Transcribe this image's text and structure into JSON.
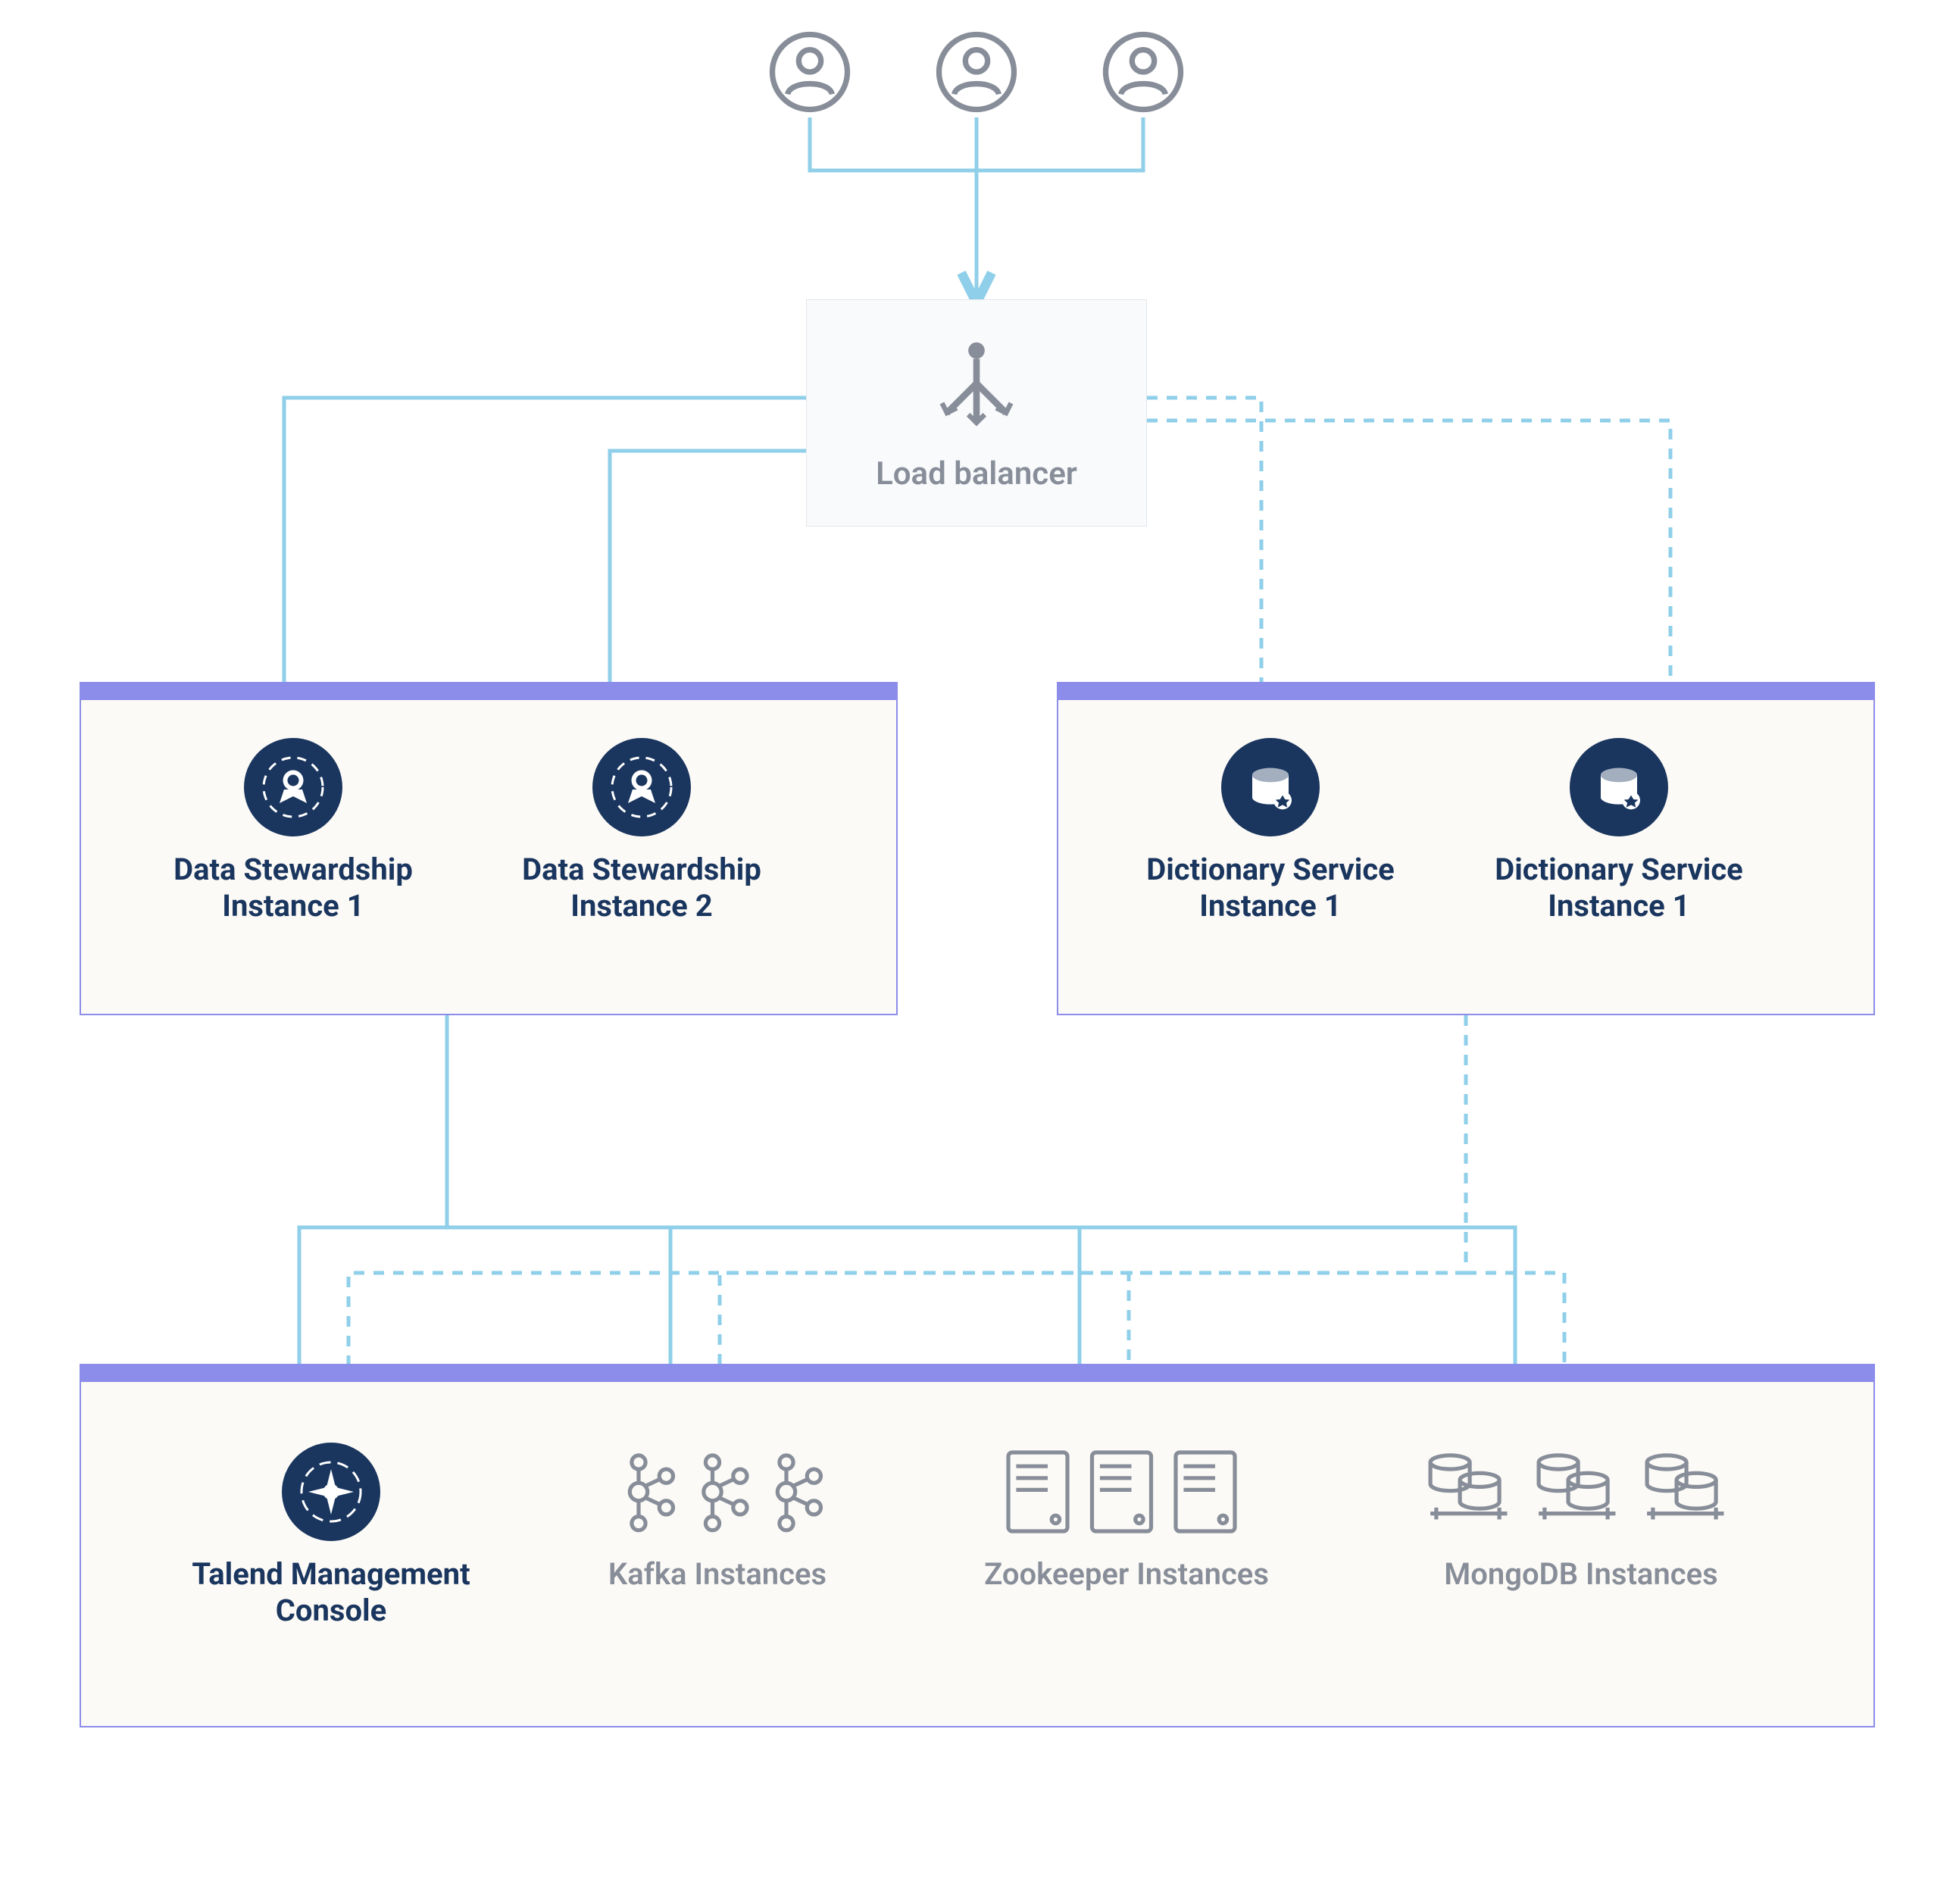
{
  "users": {
    "count": 3
  },
  "load_balancer": {
    "label": "Load balancer"
  },
  "panels": {
    "left": {
      "nodes": [
        {
          "label_l1": "Data Stewardship",
          "label_l2": "Instance 1"
        },
        {
          "label_l1": "Data Stewardship",
          "label_l2": "Instance 2"
        }
      ]
    },
    "right": {
      "nodes": [
        {
          "label_l1": "Dictionary Service",
          "label_l2": "Instance 1"
        },
        {
          "label_l1": "Dictionary Service",
          "label_l2": "Instance 1"
        }
      ]
    },
    "bottom": {
      "nodes": [
        {
          "label_l1": "Talend Management",
          "label_l2": "Console",
          "kind": "tmc"
        },
        {
          "label_l1": "Kafka Instances",
          "label_l2": "",
          "kind": "kafka"
        },
        {
          "label_l1": "Zookeeper Instances",
          "label_l2": "",
          "kind": "zookeeper"
        },
        {
          "label_l1": "MongoDB Instances",
          "label_l2": "",
          "kind": "mongodb"
        }
      ]
    }
  },
  "colors": {
    "connector": "#8FCFE9",
    "panel_border": "#8C8CEB",
    "panel_fill": "#FCFAF6",
    "icon_gray": "#888E99",
    "icon_navy": "#1A365F",
    "label_navy": "#1A365F"
  }
}
